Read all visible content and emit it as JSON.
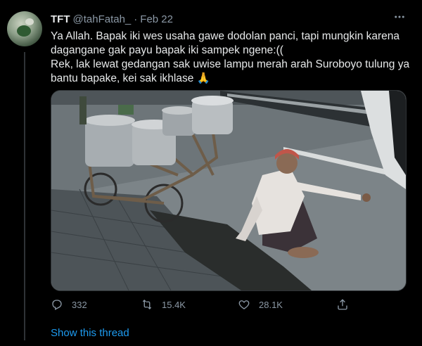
{
  "tweet": {
    "author_name": "TFT",
    "author_handle": "@tahFatah_",
    "separator": "·",
    "time": "Feb 22",
    "more_icon": "more-dots-icon",
    "text_lines": [
      "Ya Allah. Bapak iki wes usaha gawe dodolan panci, tapi mungkin karena",
      "dagangane gak payu bapak iki sampek ngene:((",
      "Rek, lak lewat gedangan sak uwise lampu merah arah Suroboyo tulung ya",
      "bantu bapake, kei sak ikhlase 🙏"
    ],
    "media_description_icon": "photo-icon"
  },
  "actions": {
    "reply": {
      "icon": "reply-icon",
      "count": "332"
    },
    "retweet": {
      "icon": "retweet-icon",
      "count": "15.4K"
    },
    "like": {
      "icon": "heart-icon",
      "count": "28.1K"
    },
    "share": {
      "icon": "share-icon"
    }
  },
  "show_thread": "Show this thread",
  "colors": {
    "background": "#000000",
    "text": "#e7e9ea",
    "muted": "#8b98a5",
    "link": "#1d9bf0",
    "divider": "#2f3336"
  }
}
